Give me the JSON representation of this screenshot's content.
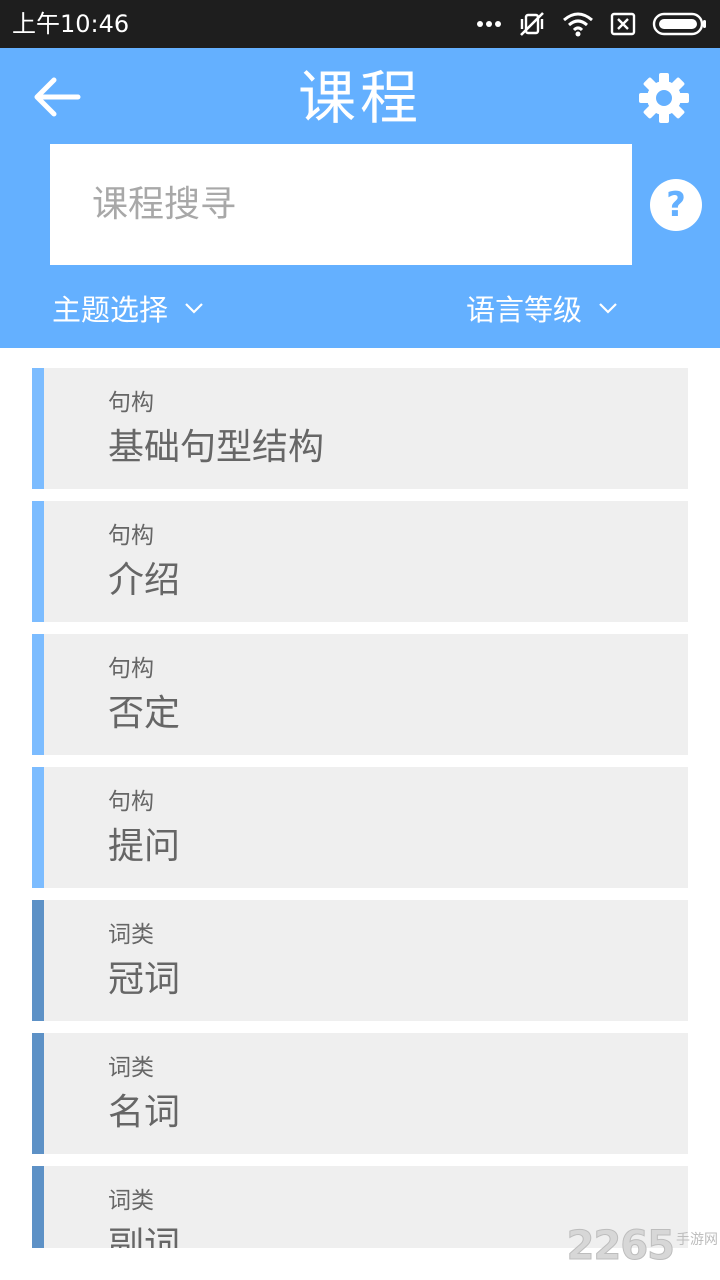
{
  "status_bar": {
    "time": "上午10:46",
    "icons": [
      "more-dots-icon",
      "mute-vibrate-icon",
      "wifi-icon",
      "sim-x-icon",
      "battery-icon"
    ]
  },
  "header": {
    "title": "课程",
    "back_icon": "back-arrow-icon",
    "settings_icon": "gear-icon",
    "search_placeholder": "课程搜寻",
    "help_label": "?",
    "filters": {
      "topic_label": "主题选择",
      "level_label": "语言等级"
    }
  },
  "courses": [
    {
      "category": "句构",
      "title": "基础句型结构"
    },
    {
      "category": "句构",
      "title": "介绍"
    },
    {
      "category": "句构",
      "title": "否定"
    },
    {
      "category": "句构",
      "title": "提问"
    },
    {
      "category": "词类",
      "title": "冠词"
    },
    {
      "category": "词类",
      "title": "名词"
    },
    {
      "category": "词类",
      "title": "副词"
    }
  ],
  "colors": {
    "header_bg": "#64b0ff",
    "structure_accent": "#7cbcff",
    "wordclass_accent": "#5d91c6",
    "item_bg": "#efefef"
  },
  "watermark": {
    "number": "2265",
    "text": "手游网"
  }
}
